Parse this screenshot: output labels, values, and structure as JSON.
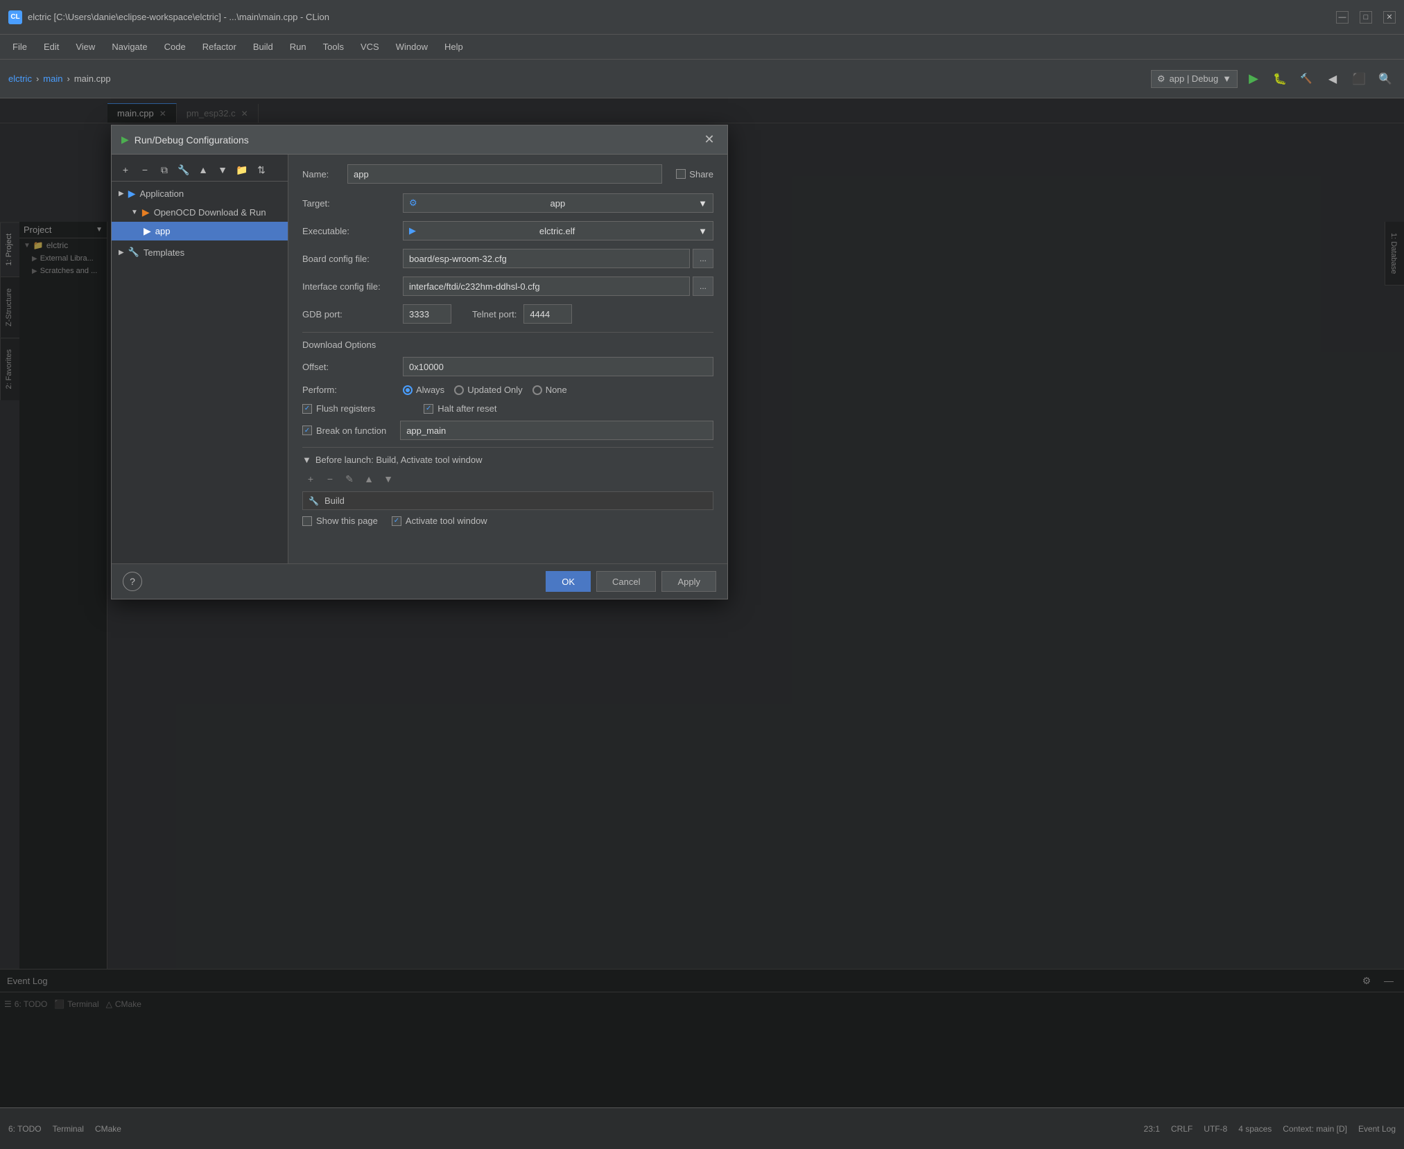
{
  "window": {
    "title": "elctric [C:\\Users\\danie\\eclipse-workspace\\elctric] - ...\\main\\main.cpp - CLion",
    "icon": "CL",
    "controls": {
      "minimize": "—",
      "maximize": "□",
      "close": "✕"
    }
  },
  "menu": {
    "items": [
      "File",
      "Edit",
      "View",
      "Navigate",
      "Code",
      "Refactor",
      "Build",
      "Run",
      "Tools",
      "VCS",
      "Window",
      "Help"
    ]
  },
  "toolbar": {
    "project": "elctric",
    "breadcrumb_main": "main",
    "breadcrumb_file": "main.cpp",
    "run_config": "app | Debug",
    "run_icon": "▶",
    "debug_icon": "🐛",
    "search_icon": "🔍"
  },
  "tabs": {
    "items": [
      "main.cpp",
      "pm_esp32.c"
    ]
  },
  "sidebar": {
    "title": "Project",
    "items": [
      {
        "label": "Project",
        "icon": "folder"
      },
      {
        "label": "elctric",
        "icon": "folder",
        "indent": 1
      },
      {
        "label": "External Libraries",
        "icon": "folder",
        "indent": 1
      },
      {
        "label": "Scratches and Consoles",
        "icon": "folder",
        "indent": 1
      }
    ]
  },
  "side_tabs": [
    "1: Project",
    "2: Favorites",
    "Z-Structure"
  ],
  "right_tabs": [
    "1: Database"
  ],
  "dialog": {
    "title": "Run/Debug Configurations",
    "title_icon": "▶",
    "close_btn": "✕",
    "config_toolbar": {
      "add_btn": "+",
      "remove_btn": "−",
      "copy_btn": "⧉",
      "edit_btn": "🔧",
      "move_up_btn": "▲",
      "move_down_btn": "▼",
      "folder_btn": "📁",
      "sort_btn": "⇅"
    },
    "tree": {
      "items": [
        {
          "label": "Application",
          "icon": "▶",
          "indent": 0,
          "expanded": true,
          "type": "category"
        },
        {
          "label": "OpenOCD Download & Run",
          "icon": "▶",
          "indent": 1,
          "expanded": true,
          "type": "category"
        },
        {
          "label": "app",
          "icon": "▶",
          "indent": 2,
          "selected": true,
          "type": "item"
        },
        {
          "label": "Templates",
          "icon": "🔧",
          "indent": 0,
          "type": "category"
        }
      ]
    },
    "form": {
      "name_label": "Name:",
      "name_value": "app",
      "share_label": "Share",
      "target_label": "Target:",
      "target_value": "app",
      "target_icon": "⚙",
      "executable_label": "Executable:",
      "executable_value": "elctric.elf",
      "executable_icon": "▶",
      "board_config_label": "Board config file:",
      "board_config_value": "board/esp-wroom-32.cfg",
      "browse_btn_label": "...",
      "interface_config_label": "Interface config file:",
      "interface_config_value": "interface/ftdi/c232hm-ddhsl-0.cfg",
      "gdb_port_label": "GDB port:",
      "gdb_port_value": "3333",
      "telnet_port_label": "Telnet port:",
      "telnet_port_value": "4444",
      "download_options_label": "Download Options",
      "offset_label": "Offset:",
      "offset_value": "0x10000",
      "perform_label": "Perform:",
      "perform_options": [
        "Always",
        "Updated Only",
        "None"
      ],
      "perform_selected": "Always",
      "flush_registers_label": "Flush registers",
      "flush_registers_checked": true,
      "halt_after_reset_label": "Halt after reset",
      "halt_after_reset_checked": true,
      "break_on_function_label": "Break on function",
      "break_on_function_checked": true,
      "break_on_function_value": "app_main",
      "before_launch_label": "Before launch: Build, Activate tool window",
      "before_launch_expanded": true,
      "build_label": "Build",
      "show_this_page_label": "Show this page",
      "show_this_page_checked": false,
      "activate_tool_window_label": "Activate tool window",
      "activate_tool_window_checked": true
    },
    "footer": {
      "help_btn": "?",
      "ok_btn": "OK",
      "cancel_btn": "Cancel",
      "apply_btn": "Apply"
    }
  },
  "bottom_panel": {
    "title": "Event Log",
    "settings_icon": "⚙",
    "minimize_icon": "—"
  },
  "status_bar": {
    "todo": "6: TODO",
    "terminal": "Terminal",
    "cmake": "CMake",
    "position": "23:1",
    "line_ending": "CRLF",
    "encoding": "UTF-8",
    "indent": "4 spaces",
    "context": "Context: main [D]",
    "event_log": "Event Log"
  }
}
